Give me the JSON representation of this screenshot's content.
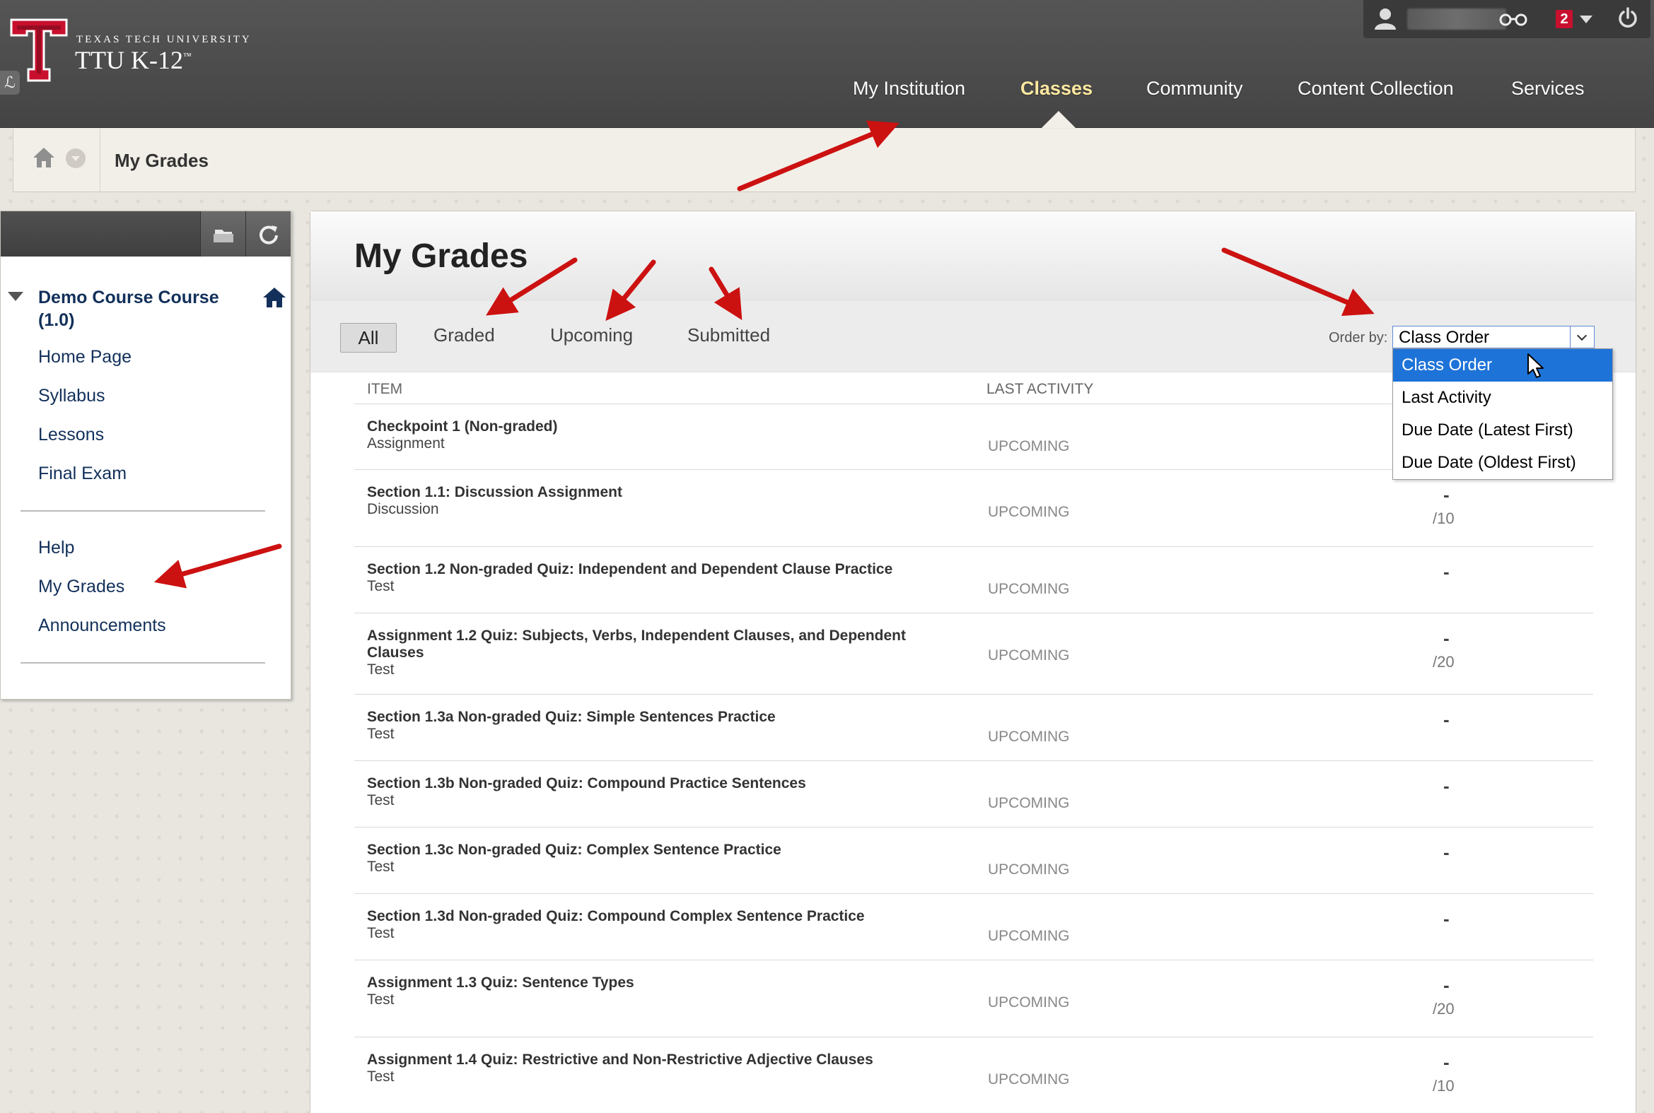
{
  "header": {
    "university": "TEXAS TECH UNIVERSITY",
    "product": "TTU K-12",
    "product_mark": "™",
    "notification_count": "2",
    "tabs": [
      {
        "label": "My Institution"
      },
      {
        "label": "Classes"
      },
      {
        "label": "Community"
      },
      {
        "label": "Content Collection"
      },
      {
        "label": "Services"
      }
    ],
    "active_tab": "Classes"
  },
  "breadcrumb": {
    "current": "My Grades"
  },
  "sidebar": {
    "course_title": "Demo Course Course (1.0)",
    "links_top": [
      {
        "label": "Home Page"
      },
      {
        "label": "Syllabus"
      },
      {
        "label": "Lessons"
      },
      {
        "label": "Final Exam"
      }
    ],
    "links_bottom": [
      {
        "label": "Help"
      },
      {
        "label": "My Grades"
      },
      {
        "label": "Announcements"
      }
    ]
  },
  "main": {
    "title": "My Grades",
    "filters": [
      {
        "label": "All"
      },
      {
        "label": "Graded"
      },
      {
        "label": "Upcoming"
      },
      {
        "label": "Submitted"
      }
    ],
    "order_by": {
      "label": "Order by:",
      "value": "Class Order",
      "options": [
        "Class Order",
        "Last Activity",
        "Due Date (Latest First)",
        "Due Date (Oldest First)"
      ]
    },
    "columns": {
      "item": "ITEM",
      "last_activity": "LAST ACTIVITY"
    },
    "rows": [
      {
        "title": "Checkpoint 1 (Non-graded)",
        "type": "Assignment",
        "activity": "UPCOMING",
        "grade": "",
        "points": ""
      },
      {
        "title": "Section 1.1: Discussion Assignment",
        "type": "Discussion",
        "activity": "UPCOMING",
        "grade": "-",
        "points": "/10"
      },
      {
        "title": "Section 1.2 Non-graded Quiz: Independent and Dependent Clause Practice",
        "type": "Test",
        "activity": "UPCOMING",
        "grade": "-",
        "points": ""
      },
      {
        "title": "Assignment 1.2 Quiz: Subjects, Verbs, Independent Clauses, and Dependent Clauses",
        "type": "Test",
        "activity": "UPCOMING",
        "grade": "-",
        "points": "/20"
      },
      {
        "title": "Section 1.3a Non-graded Quiz: Simple Sentences Practice",
        "type": "Test",
        "activity": "UPCOMING",
        "grade": "-",
        "points": ""
      },
      {
        "title": "Section 1.3b Non-graded Quiz: Compound Practice Sentences",
        "type": "Test",
        "activity": "UPCOMING",
        "grade": "-",
        "points": ""
      },
      {
        "title": "Section 1.3c Non-graded Quiz: Complex Sentence Practice",
        "type": "Test",
        "activity": "UPCOMING",
        "grade": "-",
        "points": ""
      },
      {
        "title": "Section 1.3d Non-graded Quiz: Compound Complex Sentence Practice",
        "type": "Test",
        "activity": "UPCOMING",
        "grade": "-",
        "points": ""
      },
      {
        "title": "Assignment 1.3 Quiz: Sentence Types",
        "type": "Test",
        "activity": "UPCOMING",
        "grade": "-",
        "points": "/20"
      },
      {
        "title": "Assignment 1.4 Quiz: Restrictive and Non-Restrictive Adjective Clauses",
        "type": "Test",
        "activity": "UPCOMING",
        "grade": "-",
        "points": "/10"
      }
    ]
  },
  "colors": {
    "header_bg": "#4a4a4a",
    "active_tab": "#ffe8a0",
    "link": "#12305a",
    "accent_red": "#c8102e",
    "dropdown_selected": "#1e73d8",
    "annotation_arrow": "#cc1111"
  }
}
